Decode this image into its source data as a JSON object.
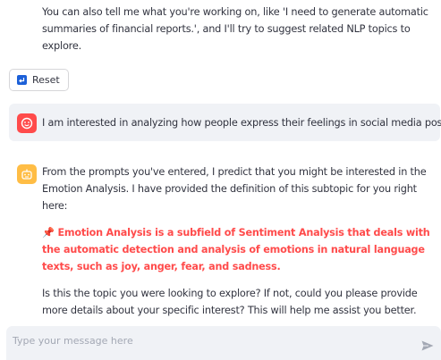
{
  "intro": {
    "text": "You can also tell me what you're working on, like 'I need to generate automatic summaries of financial reports.', and I'll try to suggest related NLP topics to explore."
  },
  "reset_button": {
    "label": "Reset",
    "icon": "reset-icon"
  },
  "messages": [
    {
      "role": "user",
      "avatar_icon": "user-face-icon",
      "avatar_color": "#ff4b4b",
      "text": "I am interested in analyzing how people express their feelings in social media posts."
    },
    {
      "role": "assistant",
      "avatar_icon": "bot-face-icon",
      "avatar_color": "#ffbd45",
      "paragraph_1": "From the prompts you've entered, I predict that you might be interested in the Emotion Analysis. I have provided the definition of this subtopic for you right here:",
      "definition_icon": "pushpin-icon",
      "definition": "Emotion Analysis is a subfield of Sentiment Analysis that deals with the automatic detection and analysis of emotions in natural language texts, such as joy, anger, fear, and sadness.",
      "paragraph_3": "Is this the topic you were looking to explore? If not, could you please provide more details about your specific interest? This will help me assist you better."
    }
  ],
  "chat_input": {
    "placeholder": "Type your message here",
    "value": "",
    "send_icon": "send-icon"
  },
  "colors": {
    "accent": "#ff4b4b",
    "bot_avatar": "#ffbd45",
    "bubble_bg": "#f0f2f6",
    "text": "#31333f"
  }
}
